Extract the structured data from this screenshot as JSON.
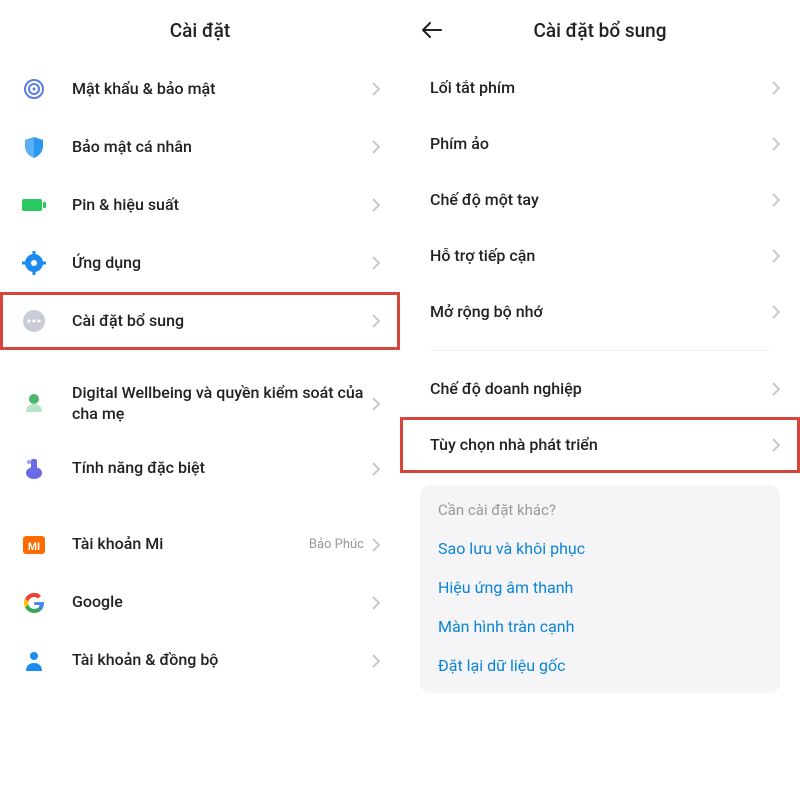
{
  "left": {
    "title": "Cài đặt",
    "items": [
      {
        "label": "Mật khẩu & bảo mật"
      },
      {
        "label": "Bảo mật cá nhân"
      },
      {
        "label": "Pin & hiệu suất"
      },
      {
        "label": "Ứng dụng"
      },
      {
        "label": "Cài đặt bổ sung"
      },
      {
        "label": "Digital Wellbeing và quyền kiểm soát của cha mẹ"
      },
      {
        "label": "Tính năng đặc biệt"
      },
      {
        "label": "Tài khoản Mi",
        "sub": "Bảo Phúc"
      },
      {
        "label": "Google"
      },
      {
        "label": "Tài khoản & đồng bộ"
      }
    ]
  },
  "right": {
    "title": "Cài đặt bổ sung",
    "items": [
      {
        "label": "Lối tắt phím"
      },
      {
        "label": "Phím ảo"
      },
      {
        "label": "Chế độ một tay"
      },
      {
        "label": "Hỗ trợ tiếp cận"
      },
      {
        "label": "Mở rộng bộ nhớ"
      },
      {
        "label": "Chế độ doanh nghiệp"
      },
      {
        "label": "Tùy chọn nhà phát triển"
      }
    ],
    "more": {
      "question": "Cần cài đặt khác?",
      "links": [
        "Sao lưu và khôi phục",
        "Hiệu ứng âm thanh",
        "Màn hình tràn cạnh",
        "Đặt lại dữ liệu gốc"
      ]
    }
  }
}
